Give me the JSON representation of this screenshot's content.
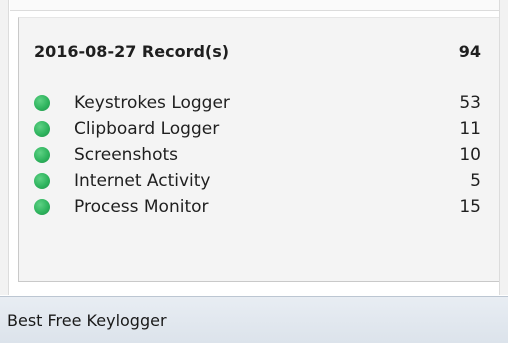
{
  "summary": {
    "title": "2016-08-27 Record(s)",
    "total": "94"
  },
  "records": [
    {
      "label": "Keystrokes Logger",
      "count": "53",
      "status_color": "#2fb45e"
    },
    {
      "label": "Clipboard Logger",
      "count": "11",
      "status_color": "#2fb45e"
    },
    {
      "label": "Screenshots",
      "count": "10",
      "status_color": "#2fb45e"
    },
    {
      "label": "Internet Activity",
      "count": "5",
      "status_color": "#2fb45e"
    },
    {
      "label": "Process Monitor",
      "count": "15",
      "status_color": "#2fb45e"
    }
  ],
  "status_bar": {
    "text": "Best Free Keylogger"
  }
}
